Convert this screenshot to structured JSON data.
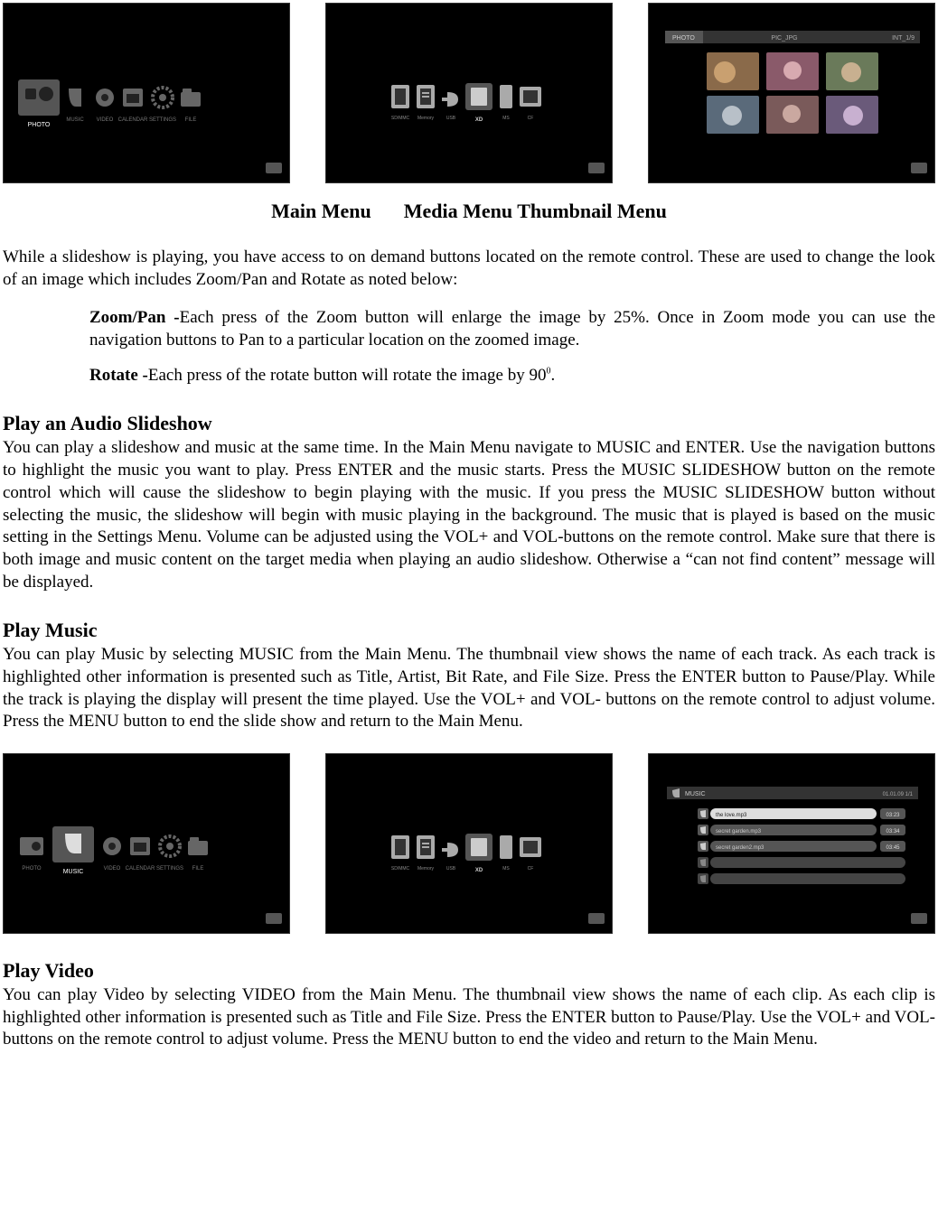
{
  "panels": {
    "row1": {
      "p1_icons": [
        "PHOTO",
        "MUSIC",
        "VIDEO",
        "CALENDAR",
        "SETTINGS",
        "FILE"
      ],
      "p2_source_icons": [
        "SD/MMC",
        "Memory",
        "USB",
        "XD",
        "MS",
        "CF"
      ],
      "p3_header": {
        "left": "PHOTO",
        "center": "PIC_JPG",
        "right": "INT_1/9"
      }
    },
    "row2": {
      "p1_icons": [
        "PHOTO",
        "MUSIC",
        "VIDEO",
        "CALENDAR",
        "SETTINGS",
        "FILE"
      ],
      "p2_source_icons": [
        "SD/MMC",
        "Memory",
        "USB",
        "XD",
        "MS",
        "CF"
      ],
      "p3_header": {
        "left": "MUSIC",
        "right": "01.01.09   1/1"
      },
      "p3_tracks": [
        {
          "title": "the love.mp3",
          "dur": "03:23"
        },
        {
          "title": "secret garden.mp3",
          "dur": "03:34"
        },
        {
          "title": "secret garden2.mp3",
          "dur": "03:45"
        },
        {
          "title": "",
          "dur": ""
        },
        {
          "title": "",
          "dur": ""
        }
      ]
    }
  },
  "menu_labels": {
    "a": "Main Menu",
    "b": "Media Menu Thumbnail Menu"
  },
  "intro": "While a slideshow is playing, you have access to on demand buttons located on the remote control. These are used to change the look of an image which includes Zoom/Pan and Rotate as noted below:",
  "zoom": {
    "label": "Zoom/Pan -",
    "body": "Each press of the Zoom button will enlarge the image by 25%. Once in Zoom mode you can use the navigation buttons to Pan to a particular location on the zoomed image."
  },
  "rotate": {
    "label": "Rotate -",
    "body_pre": "Each press of the rotate button will rotate the image by 90",
    "sup": "0",
    "body_post": "."
  },
  "sections": {
    "audio_slideshow": {
      "title": "Play an Audio Slideshow",
      "body": "You can play a slideshow and music at the same time. In the Main Menu navigate to MUSIC and ENTER. Use the navigation buttons to highlight the music you want to play. Press ENTER and the music starts. Press the MUSIC SLIDESHOW button on the remote control which will cause the slideshow to begin playing with the music. If you press the MUSIC SLIDESHOW button without selecting the music, the slideshow will begin with music playing in the background. The music that is played is based on the music setting in the Settings Menu. Volume can be adjusted using the VOL+ and VOL-buttons on the remote control. Make sure that there is both image and music content on the target media when playing an audio slideshow. Otherwise a “can not find content” message will be displayed."
    },
    "play_music": {
      "title": "Play Music",
      "body": "You can play Music by selecting MUSIC from the Main Menu. The thumbnail view shows the name of each track. As each track is highlighted other information is presented such as Title, Artist, Bit Rate, and File Size. Press the ENTER button to Pause/Play. While the track is playing the display will present the time played. Use the VOL+ and VOL- buttons on the remote control to adjust volume. Press the MENU button to end the slide show and return to the Main Menu."
    },
    "play_video": {
      "title": "Play Video",
      "body": "You can play Video by selecting VIDEO from the Main Menu. The thumbnail view shows the name of each clip. As each clip is highlighted other information is presented such as Title and File Size. Press the ENTER button to Pause/Play. Use the VOL+ and VOL- buttons on the remote control to adjust volume. Press the MENU button to end the video and return to the Main Menu."
    }
  }
}
